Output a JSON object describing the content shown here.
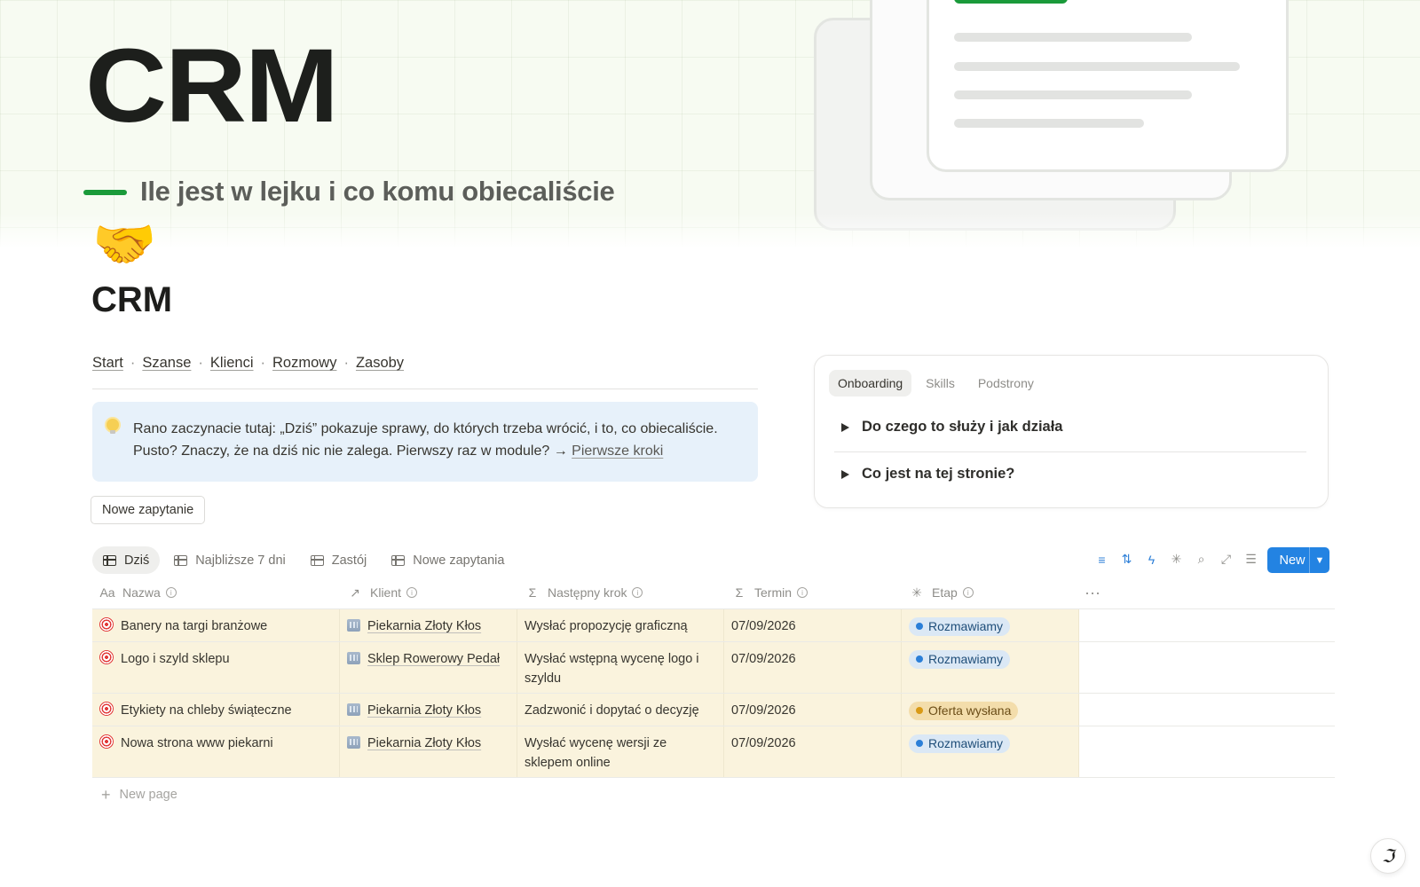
{
  "cover": {
    "title": "CRM",
    "subtitle": "Ile jest w lejku i co komu obiecaliście",
    "accent_color": "#1a9a3a"
  },
  "page": {
    "icon": "handshake-icon",
    "icon_glyph": "🤝",
    "title": "CRM"
  },
  "nav": {
    "items": [
      "Start",
      "Szanse",
      "Klienci",
      "Rozmowy",
      "Zasoby"
    ],
    "separator": "·"
  },
  "callout": {
    "icon": "lightbulb-icon",
    "text_line1": "Rano zaczynacie tutaj: „Dziś” pokazuje sprawy, do których trzeba wrócić, i to, co obiecaliście.",
    "text_line2_prefix": "Pusto? Znaczy, że na dziś nic nie zalega. Pierwszy raz w module? →",
    "link": "Pierwsze kroki"
  },
  "buttons": {
    "new_inquiry": "Nowe zapytanie",
    "new": "New",
    "new_page": "New page"
  },
  "panel": {
    "tabs": [
      "Onboarding",
      "Skills",
      "Podstrony"
    ],
    "active_tab": "Onboarding",
    "toggles": [
      "Do czego to służy i jak działa",
      "Co jest na tej stronie?"
    ]
  },
  "views": {
    "tabs": [
      "Dziś",
      "Najbliższe 7 dni",
      "Zastój",
      "Nowe zapytania"
    ],
    "active": "Dziś"
  },
  "toolbar": {
    "icons": [
      "filter-icon",
      "sort-icon",
      "automation-icon",
      "ai-sparkle-icon",
      "search-icon",
      "expand-icon",
      "settings-icon"
    ]
  },
  "table": {
    "columns": [
      "Nazwa",
      "Klient",
      "Następny krok",
      "Termin",
      "Etap"
    ],
    "rows": [
      {
        "name": "Banery na targi branżowe",
        "client": "Piekarnia Złoty Kłos",
        "next": "Wysłać propozycję graficzną",
        "due": "07/09/2026",
        "stage": "Rozmawiamy",
        "stage_color": "blue"
      },
      {
        "name": "Logo i szyld sklepu",
        "client": "Sklep Rowerowy Pedał",
        "next": "Wysłać wstępną wycenę logo i szyldu",
        "due": "07/09/2026",
        "stage": "Rozmawiamy",
        "stage_color": "blue"
      },
      {
        "name": "Etykiety na chleby świąteczne",
        "client": "Piekarnia Złoty Kłos",
        "next": "Zadzwonić i dopytać o decyzję",
        "due": "07/09/2026",
        "stage": "Oferta wysłana",
        "stage_color": "gold"
      },
      {
        "name": "Nowa strona www piekarni",
        "client": "Piekarnia Złoty Kłos",
        "next": "Wysłać wycenę wersji ze sklepem online",
        "due": "07/09/2026",
        "stage": "Rozmawiamy",
        "stage_color": "blue"
      }
    ]
  },
  "colors": {
    "row_bg": "#faf3dd",
    "primary_button": "#2383e2",
    "callout_bg": "#e7f1fa"
  }
}
